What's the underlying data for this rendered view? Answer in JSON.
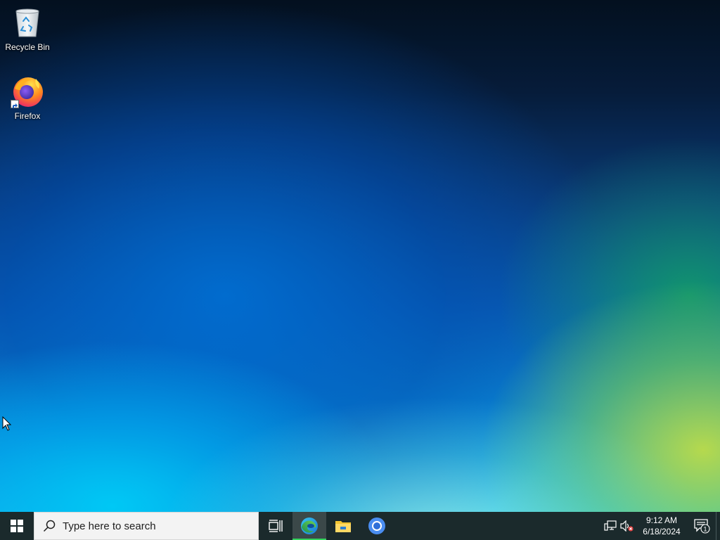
{
  "desktop": {
    "icons": [
      {
        "label": "Recycle Bin",
        "icon": "recycle-bin-icon"
      },
      {
        "label": "Firefox",
        "icon": "firefox-icon",
        "shortcut": true
      }
    ]
  },
  "taskbar": {
    "search": {
      "placeholder": "Type here to search"
    },
    "pinned_apps": [
      {
        "name": "Microsoft Edge",
        "icon": "edge-icon",
        "running": true
      },
      {
        "name": "File Explorer",
        "icon": "file-explorer-icon",
        "running": false
      },
      {
        "name": "Google Chrome",
        "icon": "chrome-icon",
        "running": false
      }
    ],
    "tray": {
      "clock_time": "9:12 AM",
      "clock_date": "6/18/2024",
      "notification_count": "1"
    },
    "colors": {
      "background": "#1b2a2c",
      "running_indicator": "#33d45c"
    }
  }
}
